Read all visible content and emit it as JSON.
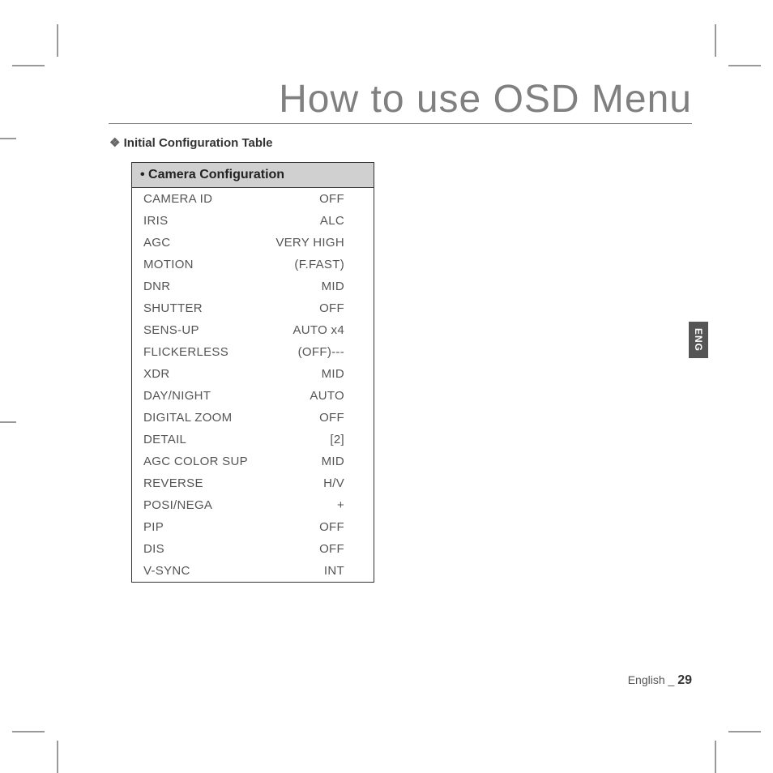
{
  "page_title": "How to use OSD Menu",
  "section_header": "Initial Configuration Table",
  "table_header": "• Camera Configuration",
  "rows": [
    {
      "label": "CAMERA ID",
      "value": "OFF"
    },
    {
      "label": "IRIS",
      "value": "ALC"
    },
    {
      "label": "AGC",
      "value": "VERY HIGH"
    },
    {
      "label": "MOTION",
      "value": "(F.FAST)"
    },
    {
      "label": "DNR",
      "value": "MID"
    },
    {
      "label": "SHUTTER",
      "value": "OFF"
    },
    {
      "label": "SENS-UP",
      "value": "AUTO x4"
    },
    {
      "label": "FLICKERLESS",
      "value": "(OFF)---"
    },
    {
      "label": "XDR",
      "value": "MID"
    },
    {
      "label": "DAY/NIGHT",
      "value": "AUTO"
    },
    {
      "label": "DIGITAL ZOOM",
      "value": "OFF"
    },
    {
      "label": "DETAIL",
      "value": "[2]"
    },
    {
      "label": "AGC COLOR SUP",
      "value": "MID"
    },
    {
      "label": "REVERSE",
      "value": "H/V"
    },
    {
      "label": "POSI/NEGA",
      "value": "+"
    },
    {
      "label": "PIP",
      "value": "OFF"
    },
    {
      "label": "DIS",
      "value": "OFF"
    },
    {
      "label": "V-SYNC",
      "value": "INT"
    }
  ],
  "lang_tab": "ENG",
  "footer_lang": "English",
  "footer_sep": " _ ",
  "footer_page": "29"
}
